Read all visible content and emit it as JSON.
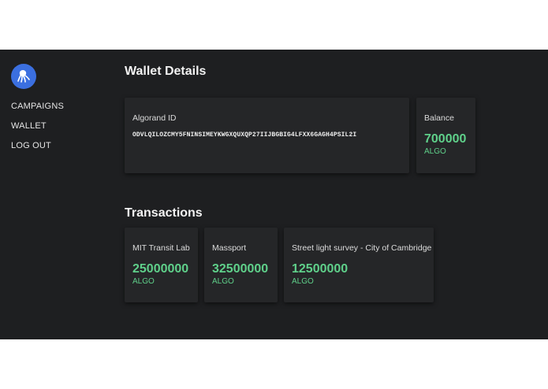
{
  "logo": {
    "icon": "octopus-icon",
    "color": "#3b6fe0"
  },
  "nav": {
    "items": [
      {
        "label": "CAMPAIGNS"
      },
      {
        "label": "WALLET"
      },
      {
        "label": "LOG OUT"
      }
    ]
  },
  "wallet": {
    "title": "Wallet Details",
    "id_label": "Algorand ID",
    "id_value": "ODVLQILOZCMY5FNINSIMEYKWGXQUXQP27IIJBGBIG4LFXX6GAGH4PSIL2I",
    "balance_label": "Balance",
    "balance_value": "700000",
    "balance_unit": "ALGO"
  },
  "transactions": {
    "title": "Transactions",
    "items": [
      {
        "name": "MIT Transit Lab",
        "amount": "25000000",
        "unit": "ALGO"
      },
      {
        "name": "Massport",
        "amount": "32500000",
        "unit": "ALGO"
      },
      {
        "name": "Street light survey - City of Cambridge",
        "amount": "12500000",
        "unit": "ALGO"
      }
    ]
  },
  "colors": {
    "background": "#1e1f21",
    "card": "#252628",
    "accent": "#5fd08a"
  }
}
